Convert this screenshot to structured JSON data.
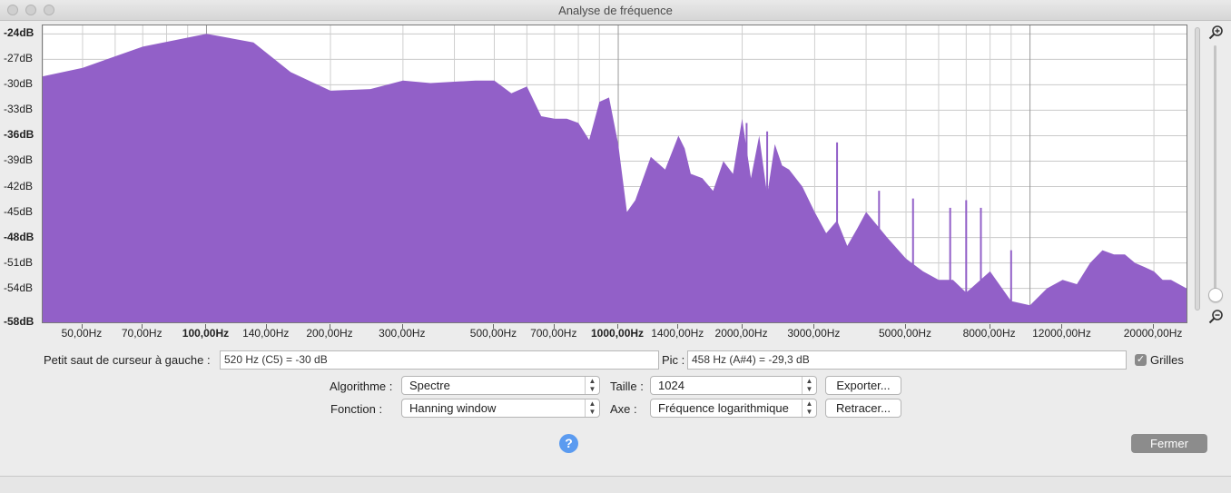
{
  "window": {
    "title": "Analyse de fréquence"
  },
  "chart_data": {
    "type": "area",
    "color": "#9260c8",
    "grid": true,
    "x_scale": "log",
    "xlim": [
      40,
      24000
    ],
    "ylim": [
      -58,
      -23
    ],
    "x_ticks": [
      "50,00Hz",
      "70,00Hz",
      "100,00Hz",
      "140,00Hz",
      "200,00Hz",
      "300,00Hz",
      "500,00Hz",
      "700,00Hz",
      "1000,00Hz",
      "1400,00Hz",
      "2000,00Hz",
      "3000,00Hz",
      "5000,00Hz",
      "8000,00Hz",
      "12000,00Hz",
      "20000,00Hz"
    ],
    "y_ticks": [
      "-24dB",
      "-27dB",
      "-30dB",
      "-33dB",
      "-36dB",
      "-39dB",
      "-42dB",
      "-45dB",
      "-48dB",
      "-51dB",
      "-54dB",
      "-58dB"
    ],
    "x": [
      40,
      50,
      70,
      100,
      130,
      160,
      200,
      250,
      300,
      350,
      450,
      500,
      550,
      600,
      650,
      700,
      750,
      800,
      850,
      900,
      950,
      1000,
      1050,
      1100,
      1200,
      1300,
      1400,
      1450,
      1500,
      1600,
      1700,
      1800,
      1900,
      2000,
      2100,
      2200,
      2300,
      2400,
      2500,
      2600,
      2800,
      3000,
      3200,
      3400,
      3600,
      3800,
      4000,
      4500,
      5000,
      5500,
      6000,
      6500,
      7000,
      8000,
      9000,
      10000,
      11000,
      12000,
      13000,
      14000,
      15000,
      16000,
      17000,
      18000,
      19000,
      20000,
      21000,
      22000,
      24000
    ],
    "y": [
      -29,
      -28,
      -25.5,
      -24,
      -25,
      -28.5,
      -30.7,
      -30.5,
      -29.5,
      -29.8,
      -29.5,
      -29.5,
      -31,
      -30.2,
      -33.7,
      -34,
      -34,
      -34.5,
      -36.5,
      -32,
      -31.5,
      -37,
      -45,
      -43.6,
      -38.5,
      -40,
      -36,
      -37.5,
      -40.5,
      -41,
      -42.5,
      -39,
      -40.5,
      -34,
      -41,
      -36,
      -43,
      -37,
      -39.5,
      -40,
      -42,
      -45,
      -47.5,
      -46,
      -49,
      -47,
      -45,
      -48,
      -50.5,
      -52,
      -53,
      -53,
      -54.5,
      -52,
      -55.5,
      -56,
      -54,
      -53,
      -53.5,
      -51,
      -49.5,
      -50,
      -50,
      -51,
      -51.5,
      -52,
      -53,
      -53,
      -54
    ],
    "highlights": [
      {
        "x": 2050,
        "y": -34.5
      },
      {
        "x": 2300,
        "y": -35.5
      },
      {
        "x": 3400,
        "y": -36.8
      },
      {
        "x": 4300,
        "y": -42.5
      },
      {
        "x": 5200,
        "y": -43.4
      },
      {
        "x": 6400,
        "y": -44.5
      },
      {
        "x": 7000,
        "y": -43.6
      },
      {
        "x": 7600,
        "y": -44.5
      },
      {
        "x": 9000,
        "y": -49.5
      }
    ]
  },
  "controls": {
    "cursor_label": "Petit saut de curseur à gauche :",
    "cursor_value": "520 Hz (C5) = -30 dB",
    "peak_label": "Pic :",
    "peak_value": "458 Hz (A#4) = -29,3 dB",
    "grids_label": "Grilles",
    "grids_checked": true,
    "algorithm_label": "Algorithme :",
    "algorithm_value": "Spectre",
    "function_label": "Fonction :",
    "function_value": "Hanning window",
    "size_label": "Taille :",
    "size_value": "1024",
    "axis_label": "Axe :",
    "axis_value": "Fréquence logarithmique",
    "export_label": "Exporter...",
    "replot_label": "Retracer...",
    "help_label": "?",
    "close_label": "Fermer"
  }
}
